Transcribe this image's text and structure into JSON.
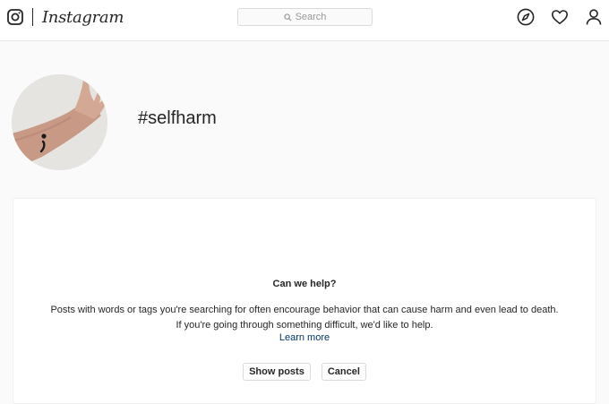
{
  "header": {
    "brand": "Instagram",
    "search_placeholder": "Search",
    "icons": [
      "compass-icon",
      "heart-icon",
      "person-icon"
    ]
  },
  "profile": {
    "hashtag": "#selfharm",
    "avatar": "wrist-semicolon-tattoo"
  },
  "help_card": {
    "title": "Can we help?",
    "line1": "Posts with words or tags you're searching for often encourage behavior that can cause harm and even lead to death.",
    "line2": "If you're going through something difficult, we'd like to help.",
    "learn_more": "Learn more",
    "show_posts_label": "Show posts",
    "cancel_label": "Cancel"
  },
  "colors": {
    "background": "#fafafa",
    "text": "#262626",
    "link": "#003569",
    "border": "#dbdbdb"
  }
}
